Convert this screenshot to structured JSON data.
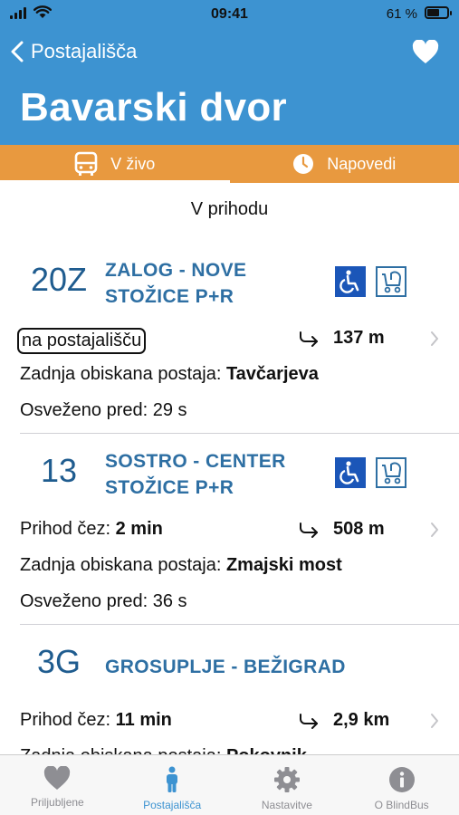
{
  "status_bar": {
    "time": "09:41",
    "battery": "61 %",
    "battery_level": 0.61
  },
  "header": {
    "back_label": "Postajališča",
    "title": "Bavarski dvor"
  },
  "tabs": [
    {
      "label": "V živo",
      "icon": "bus-icon",
      "active": true
    },
    {
      "label": "Napovedi",
      "icon": "clock-icon",
      "active": false
    }
  ],
  "section_label": "V prihodu",
  "arrivals": [
    {
      "route": "20Z",
      "dest_line1": "ZALOG - NOVE",
      "dest_line2": "STOŽICE P+R",
      "status_prefix": "",
      "status_value": "na postajališču",
      "distance": "137 m",
      "last_stop_label": "Zadnja obiskana postaja:",
      "last_stop": "Tavčarjeva",
      "refreshed": "Osveženo pred: 29 s"
    },
    {
      "route": "13",
      "dest_line1": "SOSTRO - CENTER",
      "dest_line2": "STOŽICE P+R",
      "status_prefix": "Prihod čez:",
      "status_value": "2 min",
      "distance": "508 m",
      "last_stop_label": "Zadnja obiskana postaja:",
      "last_stop": "Zmajski most",
      "refreshed": "Osveženo pred: 36 s"
    },
    {
      "route": "3G",
      "dest_line1": "GROSUPLJE - BEŽIGRAD",
      "dest_line2": "",
      "status_prefix": "Prihod čez:",
      "status_value": "11 min",
      "distance": "2,9 km",
      "last_stop_label": "Zadnja obiskana postaja:",
      "last_stop": "Pokovnik",
      "refreshed": ""
    }
  ],
  "tab_bar": [
    {
      "label": "Priljubljene",
      "icon": "heart-icon",
      "active": false
    },
    {
      "label": "Postajališča",
      "icon": "person-icon",
      "active": true
    },
    {
      "label": "Nastavitve",
      "icon": "gear-icon",
      "active": false
    },
    {
      "label": "O BlindBus",
      "icon": "info-icon",
      "active": false
    }
  ],
  "colors": {
    "header_blue": "#3d93d1",
    "tab_orange": "#e8993f",
    "route_blue": "#1f5c8f",
    "accessibility_blue": "#1b56b8"
  }
}
